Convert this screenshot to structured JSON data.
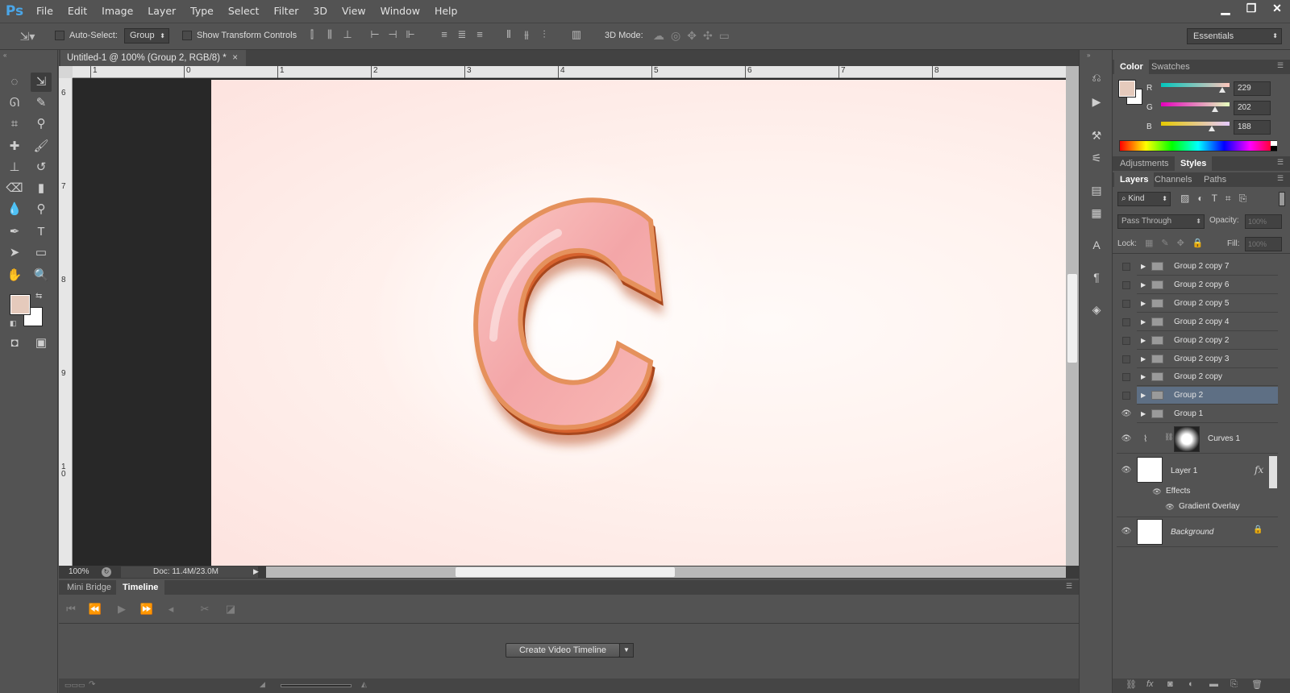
{
  "app": {
    "logo": "Ps"
  },
  "menu": [
    "File",
    "Edit",
    "Image",
    "Layer",
    "Type",
    "Select",
    "Filter",
    "3D",
    "View",
    "Window",
    "Help"
  ],
  "window_controls": {
    "minimize": "▁",
    "restore": "❐",
    "close": "✕"
  },
  "options": {
    "auto_select_label": "Auto-Select:",
    "group_value": "Group",
    "show_transform_label": "Show Transform Controls",
    "mode_3d_label": "3D Mode:",
    "workspace_value": "Essentials"
  },
  "document": {
    "tab_title": "Untitled-1 @ 100% (Group 2, RGB/8) *",
    "tab_close": "×",
    "ruler_top": [
      "1",
      "0",
      "1",
      "2",
      "3",
      "4",
      "5",
      "6",
      "7",
      "8"
    ],
    "ruler_left": [
      "6",
      "7",
      "8",
      "9",
      "10"
    ],
    "zoom": "100%",
    "doc_info": "Doc: 11.4M/23.0M"
  },
  "artwork": {
    "letter": "c",
    "fill_color": "#f3a6a8",
    "edge_color": "#d6622e"
  },
  "timeline": {
    "tabs": [
      "Mini Bridge",
      "Timeline"
    ],
    "active_tab": "Timeline",
    "create_button": "Create Video Timeline"
  },
  "color_panel": {
    "tabs": [
      "Color",
      "Swatches"
    ],
    "fg_color": "#e5cabc",
    "channels": [
      {
        "label": "R",
        "value": "229",
        "level": 0.898
      },
      {
        "label": "G",
        "value": "202",
        "level": 0.792
      },
      {
        "label": "B",
        "value": "188",
        "level": 0.737
      }
    ]
  },
  "adjust_panel": {
    "tabs": [
      "Adjustments",
      "Styles"
    ]
  },
  "layers_panel": {
    "tabs": [
      "Layers",
      "Channels",
      "Paths"
    ],
    "kind_value": "Kind",
    "blend_mode": "Pass Through",
    "opacity_label": "Opacity:",
    "opacity_value": "100%",
    "lock_label": "Lock:",
    "fill_label": "Fill:",
    "fill_value": "100%",
    "groups": [
      "Group 2 copy 7",
      "Group 2 copy 6",
      "Group 2 copy 5",
      "Group 2 copy 4",
      "Group 2 copy 2",
      "Group 2 copy 3",
      "Group 2 copy",
      "Group 2",
      "Group 1"
    ],
    "selected_group": "Group 2",
    "curves_name": "Curves 1",
    "layer1_name": "Layer 1",
    "effects_label": "Effects",
    "gradient_overlay_label": "Gradient Overlay",
    "fx_label": "fx",
    "background_name": "Background"
  }
}
